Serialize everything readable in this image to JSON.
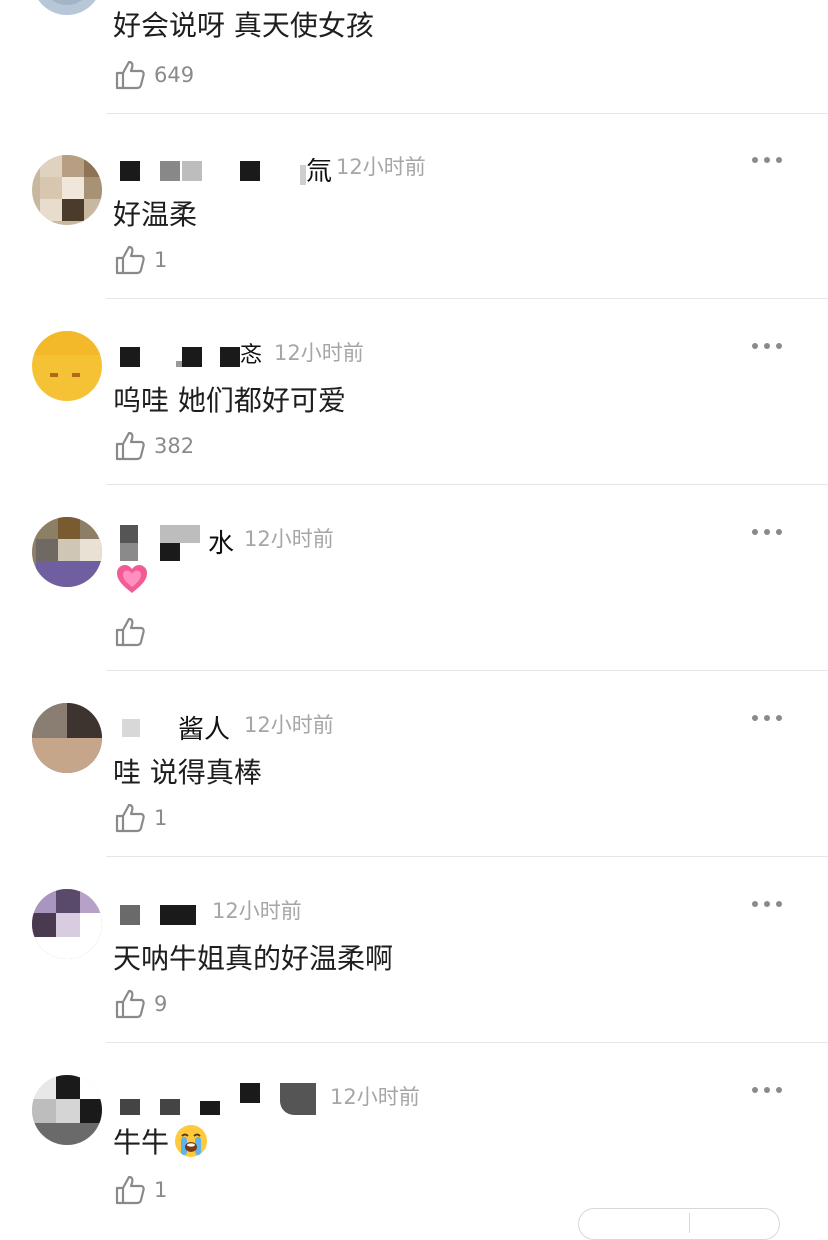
{
  "comments": [
    {
      "username": "",
      "time": "",
      "text": "好会说呀 真天使女孩",
      "likes": "649"
    },
    {
      "username": "",
      "name_tail": "氚",
      "time": "12小时前",
      "text": "好温柔",
      "likes": "1"
    },
    {
      "username": "",
      "name_tail": "忞",
      "time": "12小时前",
      "text": "呜哇 她们都好可爱",
      "likes": "382"
    },
    {
      "username": "",
      "name_tail": "水",
      "time": "12小时前",
      "text": "",
      "text_emoji": "growing-heart",
      "likes": ""
    },
    {
      "username": "",
      "name_tail": "酱人",
      "time": "12小时前",
      "text": "哇 说得真棒",
      "likes": "1"
    },
    {
      "username": "",
      "name_tail": "",
      "time": "12小时前",
      "text": "天呐牛姐真的好温柔啊",
      "likes": "9"
    },
    {
      "username": "",
      "name_tail": "",
      "time": "12小时前",
      "text": "牛牛",
      "text_emoji": "loudly-crying-face",
      "likes": "1"
    }
  ],
  "icons": {
    "like": "thumbs-up-outline-icon",
    "more": "more-dots-icon"
  },
  "colors": {
    "text": "#1e1e1e",
    "meta": "#a6a6a6",
    "icon": "#8a8a8a",
    "divider": "#e6e6e6",
    "heart": "#f25b95",
    "cry_face": "#ffc83d"
  }
}
